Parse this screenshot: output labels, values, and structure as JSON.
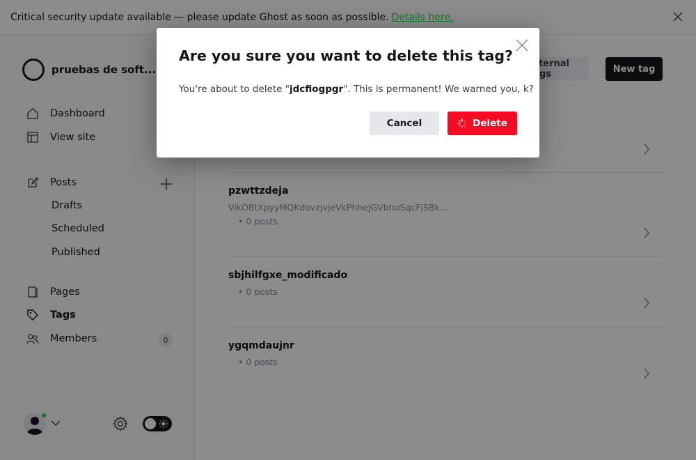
{
  "banner": {
    "text": "Critical security update available — please update Ghost as soon as possible.",
    "link": "Details here."
  },
  "sidebar": {
    "site_name": "pruebas de soft...",
    "nav": {
      "dashboard": "Dashboard",
      "view_site": "View site",
      "posts": "Posts",
      "drafts": "Drafts",
      "scheduled": "Scheduled",
      "published": "Published",
      "pages": "Pages",
      "tags": "Tags",
      "members": "Members",
      "members_count": "0"
    }
  },
  "header": {
    "internal_tags": "Internal tags",
    "new_tag": "New tag"
  },
  "tags": [
    {
      "name": "pzwttzdeja",
      "description": "VikOBtXpyyMQKdovzjvjeVkPhheJGVbhuSqcFjSBk...",
      "count": "• 0 posts"
    },
    {
      "name": "sbjhilfgxe_modificado",
      "description": "",
      "count": "• 0 posts"
    },
    {
      "name": "ygqmdaujnr",
      "description": "",
      "count": "• 0 posts"
    }
  ],
  "modal": {
    "title": "Are you sure you want to delete this tag?",
    "body_prefix": "You're about to delete \"",
    "tag_name": "jdcfiogpgr",
    "body_suffix": "\". This is permanent! We warned you, k?",
    "cancel": "Cancel",
    "delete": "Delete"
  },
  "colors": {
    "accent_green": "#30cf43",
    "danger_red": "#f50b23",
    "dark": "#15171a"
  }
}
